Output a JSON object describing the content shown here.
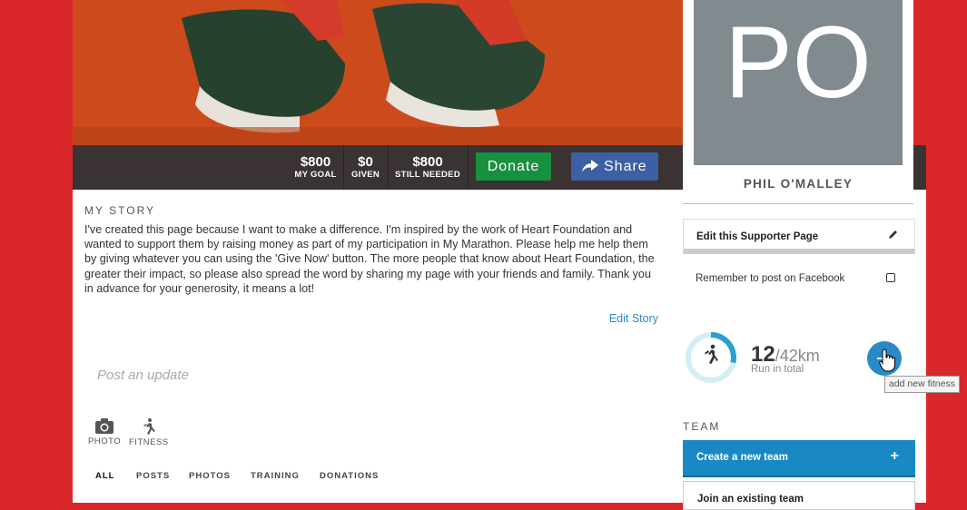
{
  "goal": {
    "my_goal_amount": "$800",
    "my_goal_label": "MY GOAL",
    "given_amount": "$0",
    "given_label": "GIVEN",
    "needed_amount": "$800",
    "needed_label": "STILL NEEDED"
  },
  "actions": {
    "donate": "Donate",
    "share": "Share"
  },
  "profile": {
    "initials": "PO",
    "name": "PHIL O'MALLEY"
  },
  "story": {
    "heading": "MY STORY",
    "text": "I've created this page because I want to make a difference. I'm inspired by the work of Heart Foundation and wanted to support them by raising money as part of my participation in My Marathon. Please help me help them by giving whatever you can using the 'Give Now' button. The more people that know about Heart Foundation, the greater their impact, so please also spread the word by sharing my page with your friends and family. Thank you in advance for your generosity, it means a lot!",
    "edit_link": "Edit Story"
  },
  "post": {
    "placeholder": "Post an update"
  },
  "tools": {
    "photo": "PHOTO",
    "fitness": "FITNESS"
  },
  "tabs": [
    "ALL",
    "POSTS",
    "PHOTOS",
    "TRAINING",
    "DONATIONS"
  ],
  "sidebar": {
    "edit_page": "Edit this Supporter Page",
    "facebook_reminder": "Remember to post on Facebook",
    "fitness_value": "12",
    "fitness_total": "/42km",
    "fitness_caption": "Run in total",
    "fitness_progress": 0.2857,
    "add_tooltip": "add new fitness",
    "team_heading": "TEAM",
    "create_team": "Create a new team",
    "join_team": "Join an existing team"
  },
  "colors": {
    "donate": "#17913f",
    "share": "#3d5fa5",
    "accent": "#2a8ac6",
    "background": "#d9272a"
  }
}
